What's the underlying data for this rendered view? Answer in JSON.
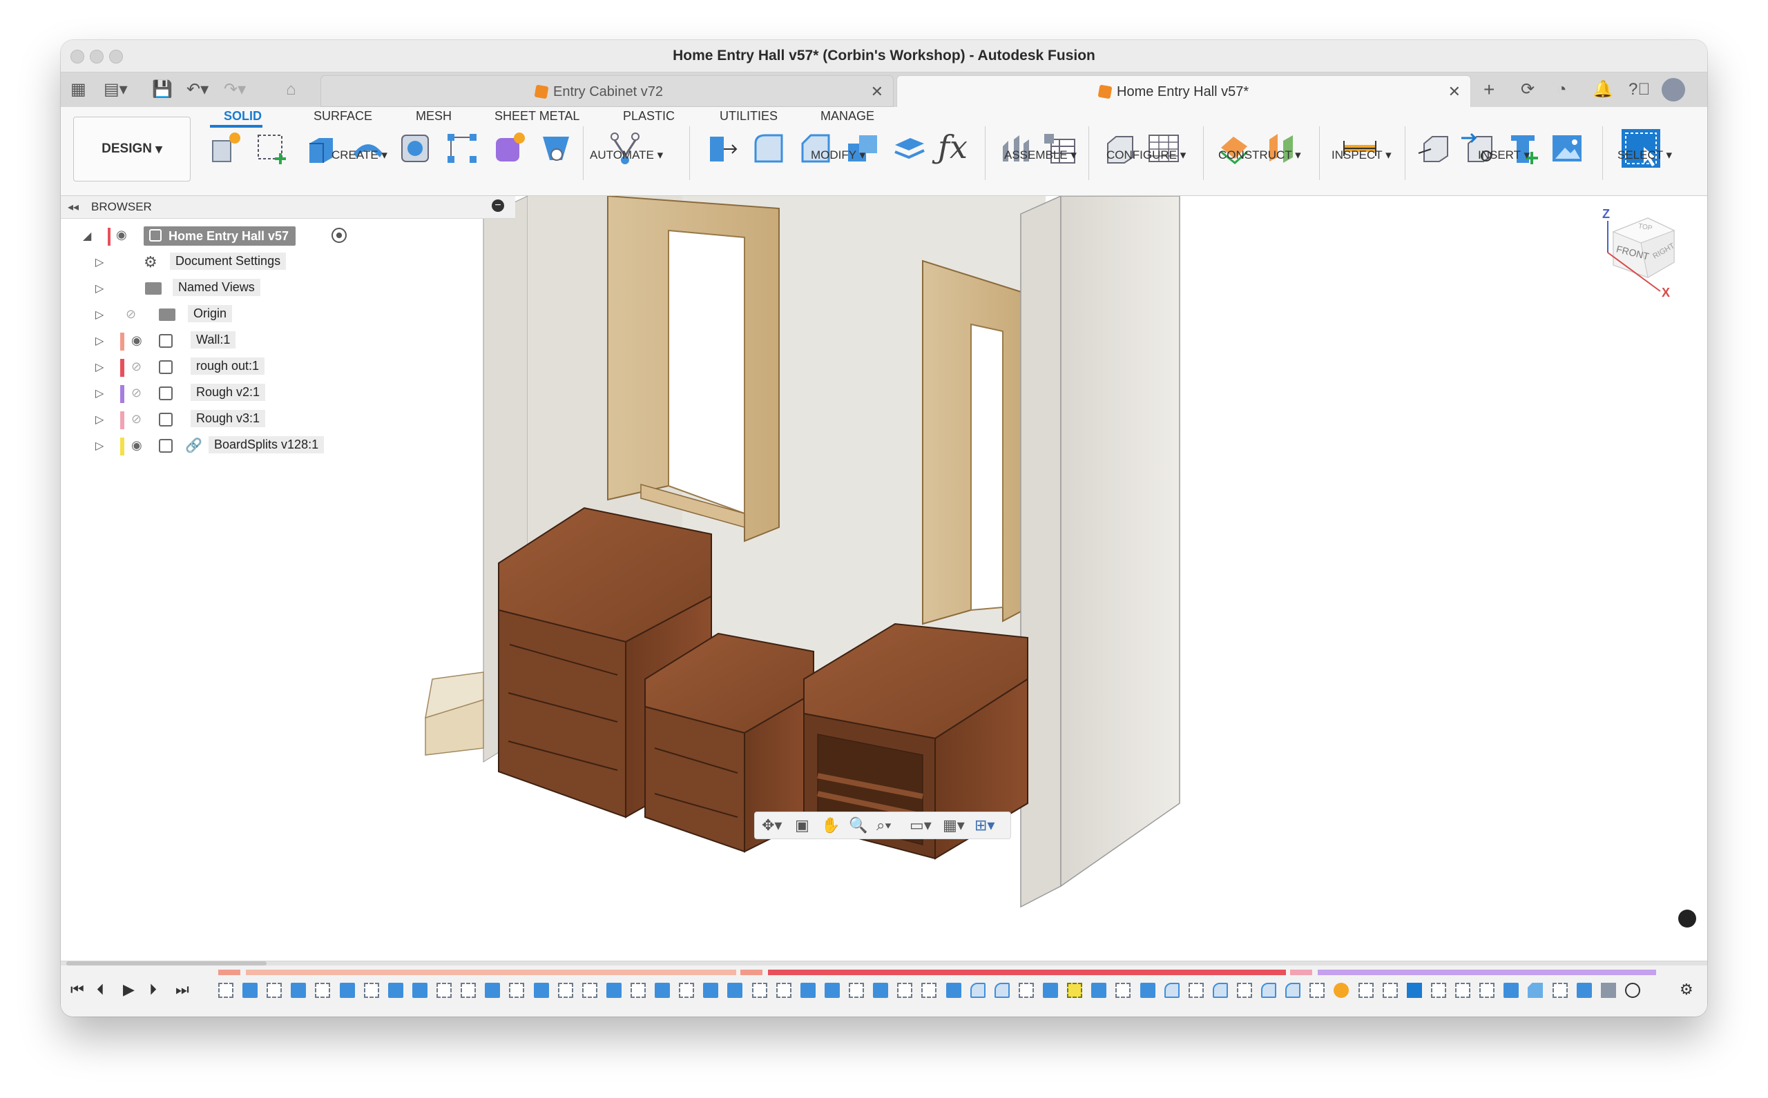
{
  "window": {
    "title": "Home Entry Hall v57* (Corbin's Workshop) - Autodesk Fusion"
  },
  "tabs": [
    {
      "label": "Entry Cabinet v72",
      "active": false
    },
    {
      "label": "Home Entry Hall v57*",
      "active": true
    }
  ],
  "ribbon": {
    "workspace": "DESIGN",
    "workspace_tabs": [
      "SOLID",
      "SURFACE",
      "MESH",
      "SHEET METAL",
      "PLASTIC",
      "UTILITIES",
      "MANAGE"
    ],
    "active_tab": "SOLID",
    "groups": [
      "CREATE",
      "AUTOMATE",
      "MODIFY",
      "ASSEMBLE",
      "CONFIGURE",
      "CONSTRUCT",
      "INSPECT",
      "INSERT",
      "SELECT"
    ]
  },
  "browser": {
    "header": "BROWSER",
    "root": "Home Entry Hall v57",
    "items": [
      {
        "label": "Document Settings",
        "icon": "gear-icon"
      },
      {
        "label": "Named Views",
        "icon": "folder-icon"
      },
      {
        "label": "Origin",
        "icon": "folder-icon"
      },
      {
        "label": "Wall:1",
        "icon": "component-icon",
        "color": "#f29a8a"
      },
      {
        "label": "rough out:1",
        "icon": "body-icon",
        "color": "#e8505b"
      },
      {
        "label": "Rough v2:1",
        "icon": "body-icon",
        "color": "#a77de0"
      },
      {
        "label": "Rough v3:1",
        "icon": "body-icon",
        "color": "#f2a3b3"
      },
      {
        "label": "BoardSplits v128:1",
        "icon": "link-icon",
        "color": "#f5e04a"
      }
    ]
  },
  "viewcube": {
    "axis_z": "Z",
    "axis_x": "X",
    "front": "FRONT",
    "right": "RIGHT",
    "top": "TOP"
  },
  "colors": {
    "accent": "#1a7bd0",
    "wood": "#8a4f2e",
    "wall": "#ecebe6"
  }
}
